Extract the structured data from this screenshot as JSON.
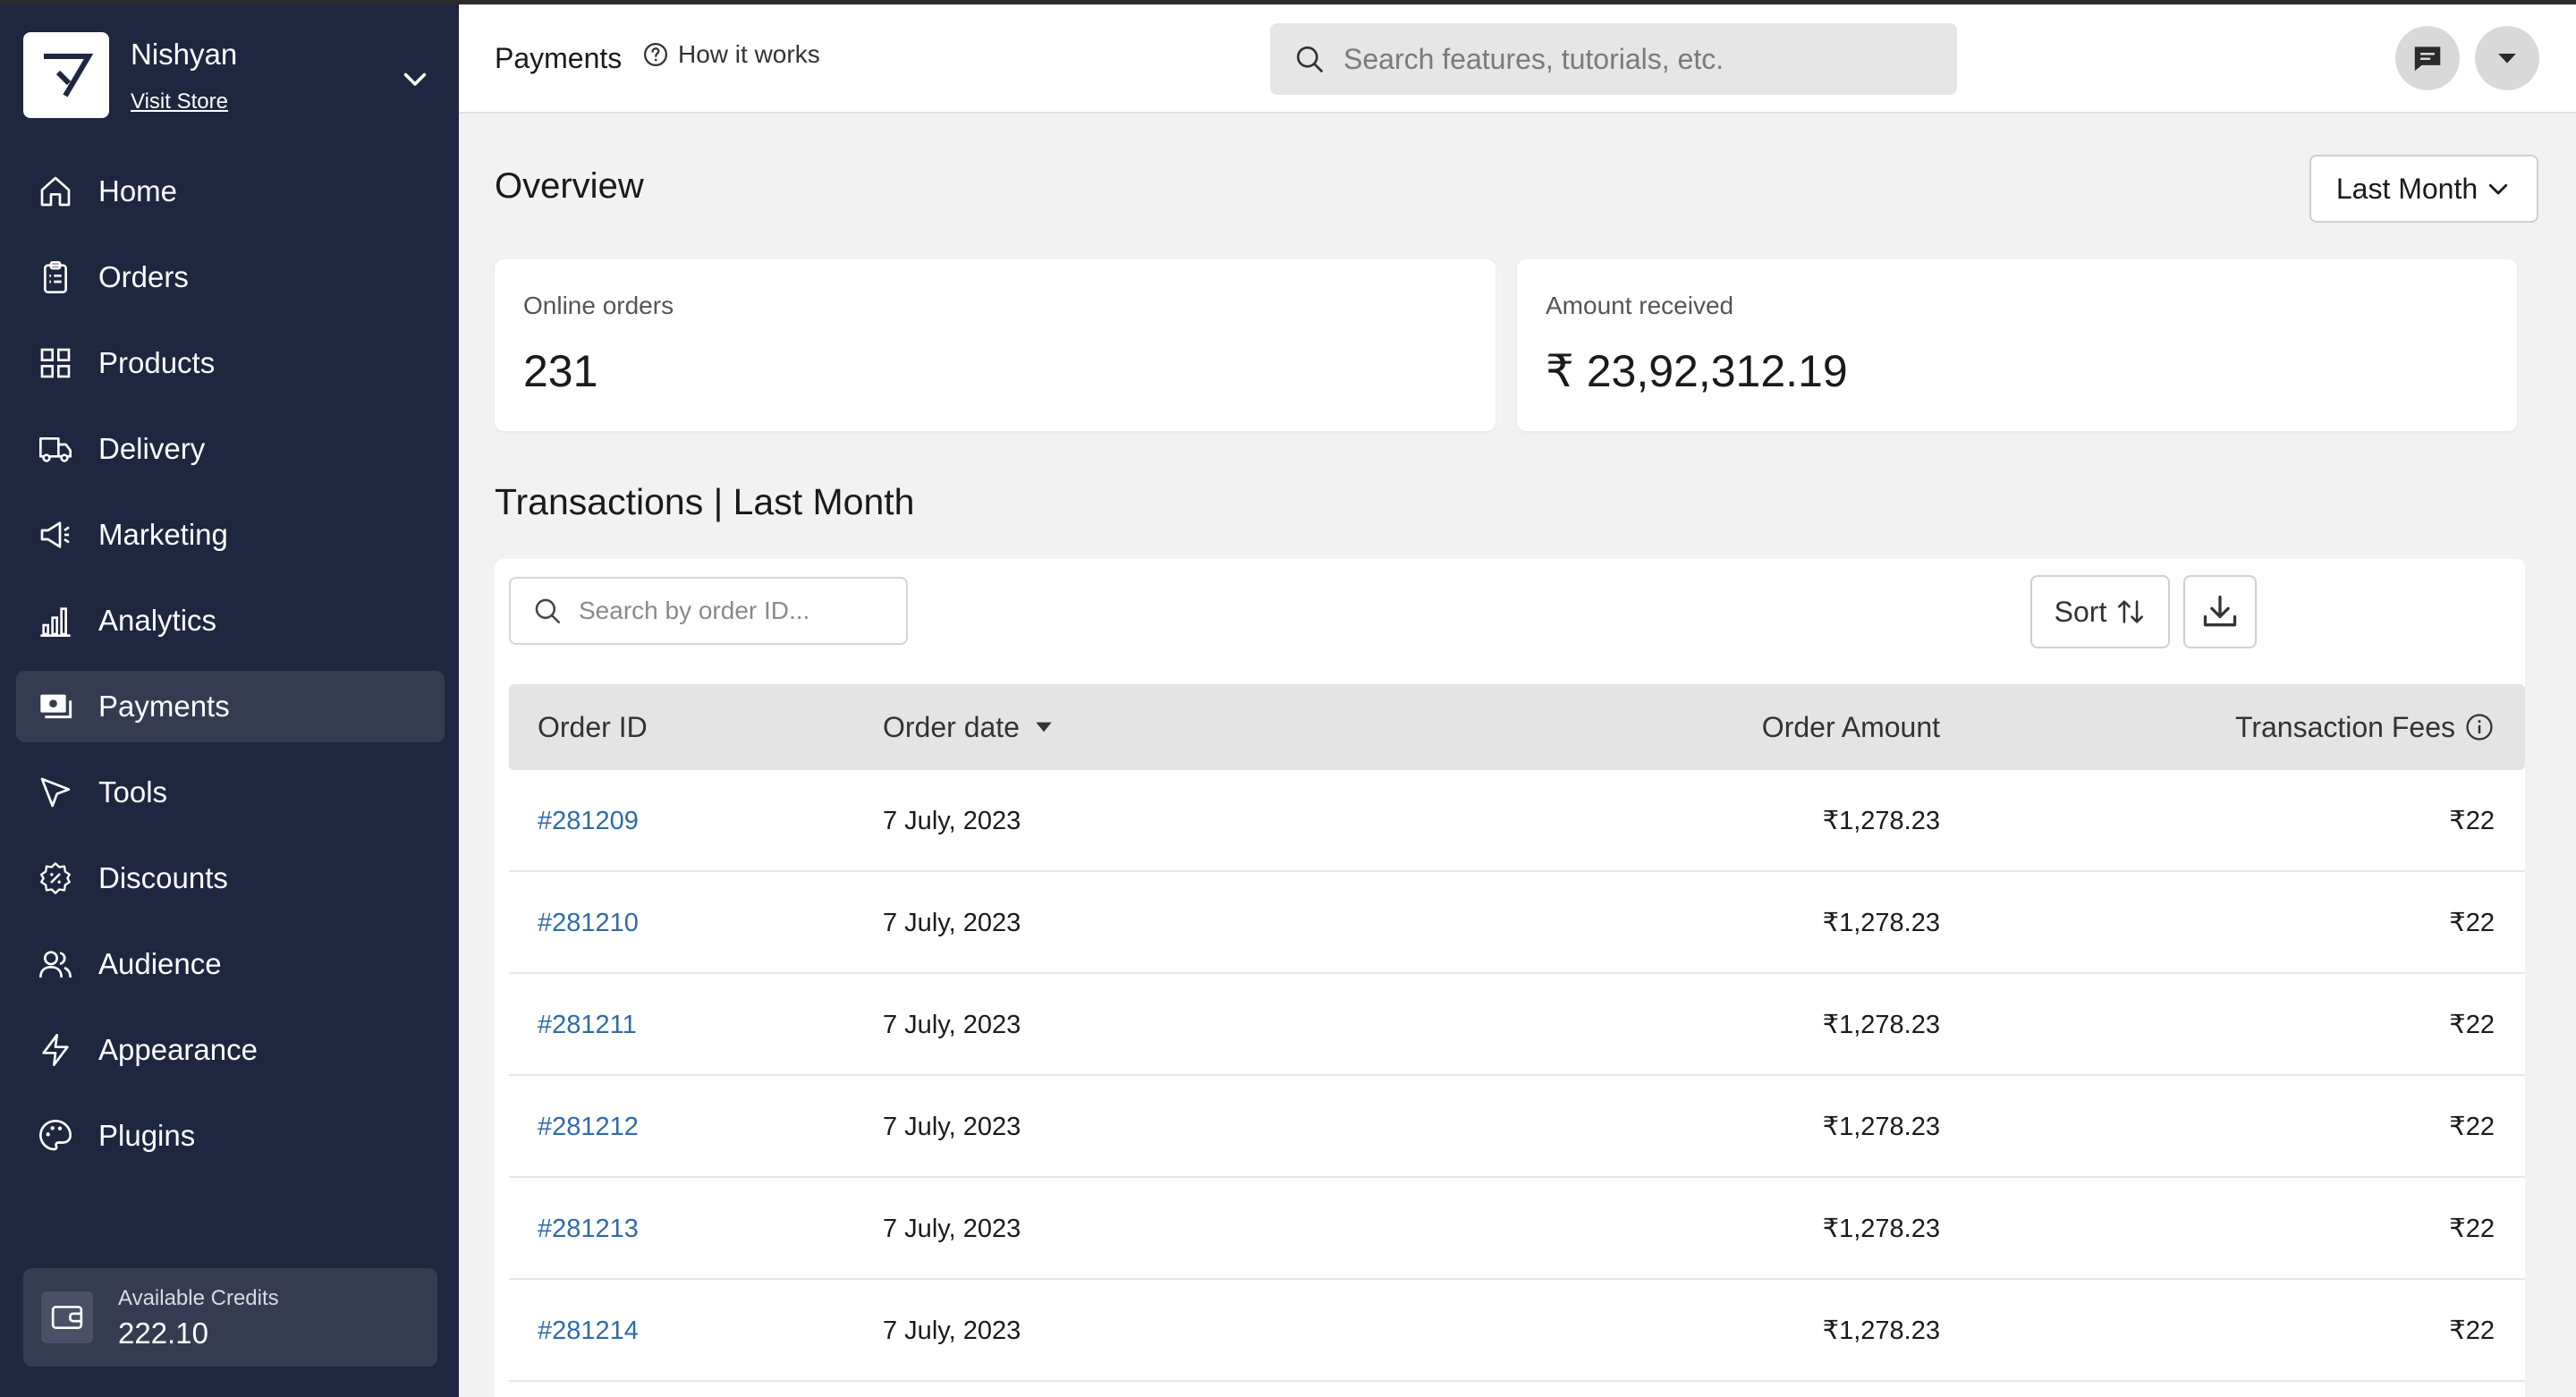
{
  "store": {
    "name": "Nishyan",
    "visit_label": "Visit Store"
  },
  "nav": {
    "items": [
      {
        "label": "Home",
        "icon": "home-icon"
      },
      {
        "label": "Orders",
        "icon": "clipboard-icon"
      },
      {
        "label": "Products",
        "icon": "grid-icon"
      },
      {
        "label": "Delivery",
        "icon": "truck-icon"
      },
      {
        "label": "Marketing",
        "icon": "megaphone-icon"
      },
      {
        "label": "Analytics",
        "icon": "bar-chart-icon"
      },
      {
        "label": "Payments",
        "icon": "money-icon",
        "active": true
      },
      {
        "label": "Tools",
        "icon": "cursor-arrow-icon"
      },
      {
        "label": "Discounts",
        "icon": "discount-badge-icon"
      },
      {
        "label": "Audience",
        "icon": "users-icon"
      },
      {
        "label": "Appearance",
        "icon": "lightning-icon"
      },
      {
        "label": "Plugins",
        "icon": "palette-icon"
      }
    ]
  },
  "credits": {
    "label": "Available Credits",
    "value": "222.10"
  },
  "header": {
    "title": "Payments",
    "how_it_works": "How it works",
    "search_placeholder": "Search features, tutorials, etc."
  },
  "overview": {
    "title": "Overview",
    "period": "Last Month",
    "cards": [
      {
        "label": "Online orders",
        "value": "231"
      },
      {
        "label": "Amount received",
        "value": "₹ 23,92,312.19"
      }
    ]
  },
  "transactions": {
    "title": "Transactions | Last Month",
    "search_placeholder": "Search by order ID...",
    "sort_label": "Sort",
    "columns": [
      "Order ID",
      "Order date",
      "Order Amount",
      "Transaction Fees"
    ],
    "rows": [
      {
        "id": "#281209",
        "date": "7 July, 2023",
        "amount": "₹1,278.23",
        "fee": "₹22"
      },
      {
        "id": "#281210",
        "date": "7 July, 2023",
        "amount": "₹1,278.23",
        "fee": "₹22"
      },
      {
        "id": "#281211",
        "date": "7 July, 2023",
        "amount": "₹1,278.23",
        "fee": "₹22"
      },
      {
        "id": "#281212",
        "date": "7 July, 2023",
        "amount": "₹1,278.23",
        "fee": "₹22"
      },
      {
        "id": "#281213",
        "date": "7 July, 2023",
        "amount": "₹1,278.23",
        "fee": "₹22"
      },
      {
        "id": "#281214",
        "date": "7 July, 2023",
        "amount": "₹1,278.23",
        "fee": "₹22"
      }
    ]
  },
  "colors": {
    "sidebar_bg": "#1e2640",
    "sidebar_active": "#353c52",
    "link": "#2f6aa8",
    "page_bg": "#f2f2f2"
  }
}
